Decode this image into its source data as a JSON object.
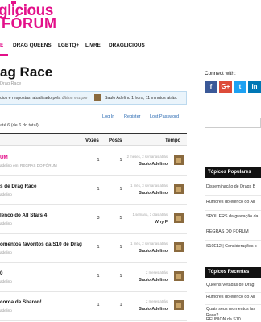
{
  "logo": {
    "line1": "glicious",
    "line2": "FÓRUM"
  },
  "nav": [
    "E",
    "DRAG QUEENS",
    "LGBTQ+",
    "LIVRE",
    "DRAGLICIOUS"
  ],
  "forum": {
    "title": "ag Race",
    "breadcrumb": "Drag Race"
  },
  "notice": {
    "text_prefix": "cios e respostas, atualizado pela ",
    "text_italic": "última vez por",
    "user_line": "Saulo Adelino 1 hora, 11 minutos atrás."
  },
  "account_links": {
    "login": "Log In",
    "register": "Register",
    "lost_password": "Lost Password"
  },
  "pagination": {
    "text": "até 6 (de 6 do total)"
  },
  "table": {
    "headers": {
      "votes": "Vozes",
      "posts": "Posts",
      "time": "Tempo"
    },
    "rows": [
      {
        "title": "UM",
        "meta": "adelino  em:  REGRAS DO FÓRUM",
        "votes": "1",
        "posts": "1",
        "ago": "2 meses, 2 semanas atrás",
        "by": "Saulo Adelino",
        "highlight": true
      },
      {
        "title": "s de Drag Race",
        "meta": "adelino",
        "votes": "1",
        "posts": "1",
        "ago": "1 mês, 3 semanas atrás",
        "by": "Saulo Adelino",
        "highlight": false
      },
      {
        "title": "lenco do All Stars 4",
        "meta": "adelino",
        "votes": "3",
        "posts": "5",
        "ago": "1 semana, 3 dias atrás",
        "by": "Why F",
        "highlight": false
      },
      {
        "title": "omentos favoritos da S10 de Drag",
        "meta": "adelino",
        "votes": "1",
        "posts": "1",
        "ago": "1 mês, 2 semanas atrás",
        "by": "Saulo Adelino",
        "highlight": false
      },
      {
        "title": "0",
        "meta": "adelino",
        "votes": "1",
        "posts": "1",
        "ago": "2 meses atrás",
        "by": "Saulo Adelino",
        "highlight": false
      },
      {
        "title": "coroa de Sharon!",
        "meta": "adelino",
        "votes": "1",
        "posts": "1",
        "ago": "2 meses atrás",
        "by": "Saulo Adelino",
        "highlight": false
      }
    ]
  },
  "sidebar": {
    "connect_heading": "Connect with:",
    "social": [
      {
        "icon": "facebook-icon",
        "glyph": "f",
        "color": "#3b5998"
      },
      {
        "icon": "google-plus-icon",
        "glyph": "G+",
        "color": "#dd4b39"
      },
      {
        "icon": "twitter-icon",
        "glyph": "t",
        "color": "#1da1f2"
      },
      {
        "icon": "linkedin-icon",
        "glyph": "in",
        "color": "#0077b5"
      }
    ],
    "popular": {
      "heading": "Tópicos Populares",
      "items": [
        "Disseminação de Drags B",
        "Rumores do elenco do All",
        "SPOILERS da gravação da",
        "REGRAS DO FÓRUM",
        "S10E12 | Considerações c"
      ]
    },
    "recent": {
      "heading": "Tópicos Recentes",
      "items": [
        "Queens Vetadas de Drag",
        "Rumores do elenco do All",
        "Quais seus momentos fav",
        "Race?",
        "REUNION da S10"
      ]
    }
  },
  "colors": {
    "brand": "#e3108a",
    "link": "#2a6ab2",
    "notice_bg": "#eaf4fb"
  }
}
